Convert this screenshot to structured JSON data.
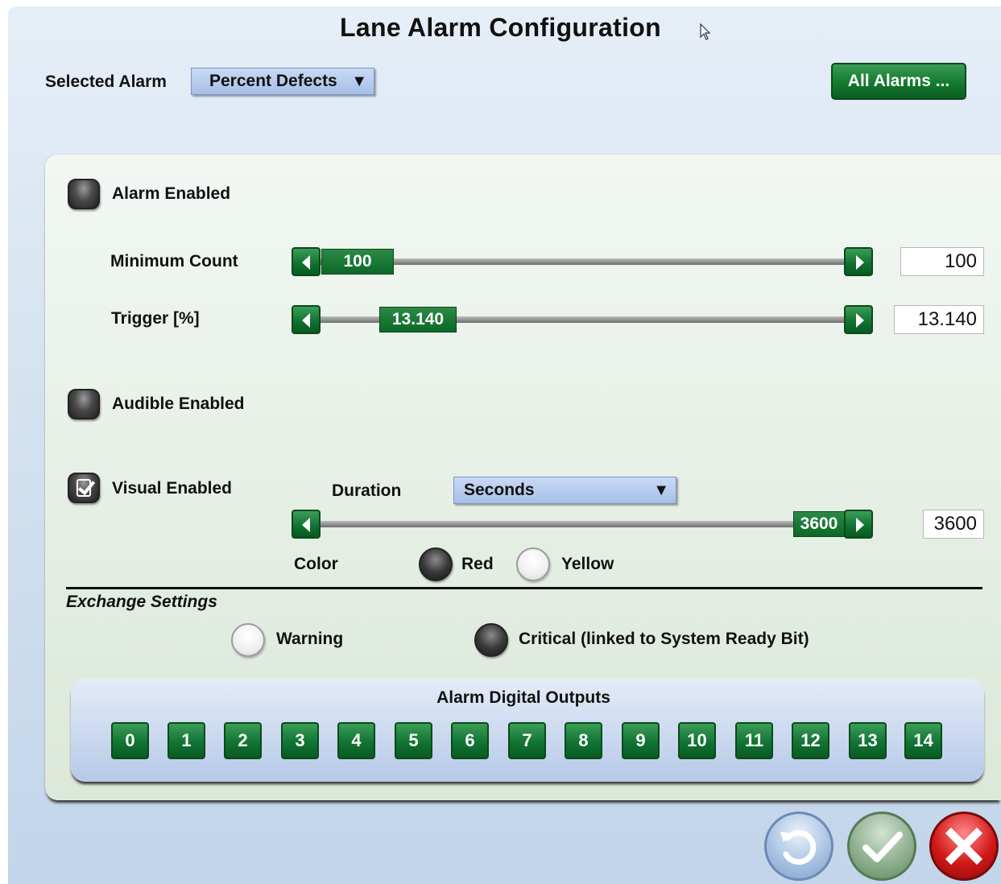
{
  "window": {
    "title": "Lane Alarm Configuration"
  },
  "selected_alarm": {
    "label": "Selected Alarm",
    "value": "Percent Defects",
    "arrow_icon": "dropdown-arrow-icon"
  },
  "all_alarms_button": "All Alarms ...",
  "alarm_enabled": {
    "label": "Alarm Enabled",
    "checked": false
  },
  "minimum_count": {
    "label": "Minimum Count",
    "slider_value": "100",
    "field_value": "100"
  },
  "trigger": {
    "label": "Trigger [%]",
    "slider_value": "13.140",
    "field_value": "13.140"
  },
  "audible_enabled": {
    "label": "Audible Enabled",
    "checked": false
  },
  "visual_enabled": {
    "label": "Visual Enabled",
    "checked": true,
    "duration_label": "Duration",
    "duration_unit": "Seconds",
    "slider_value": "3600",
    "field_value": "3600",
    "color_label": "Color",
    "color_options": [
      {
        "label": "Red",
        "selected": true
      },
      {
        "label": "Yellow",
        "selected": false
      }
    ]
  },
  "exchange_settings": {
    "label": "Exchange Settings",
    "options": [
      {
        "label": "Warning",
        "selected": false
      },
      {
        "label": "Critical (linked to System Ready Bit)",
        "selected": true
      }
    ]
  },
  "digital_outputs": {
    "title": "Alarm Digital Outputs",
    "buttons": [
      "0",
      "1",
      "2",
      "3",
      "4",
      "5",
      "6",
      "7",
      "8",
      "9",
      "10",
      "11",
      "12",
      "13",
      "14"
    ]
  },
  "footer_buttons": {
    "undo_icon": "undo-icon",
    "ok_icon": "checkmark-icon",
    "cancel_icon": "close-icon"
  },
  "colors": {
    "accent_green": "#137a30",
    "panel_blue": "#c2d5ea",
    "cancel_red": "#d11818"
  }
}
